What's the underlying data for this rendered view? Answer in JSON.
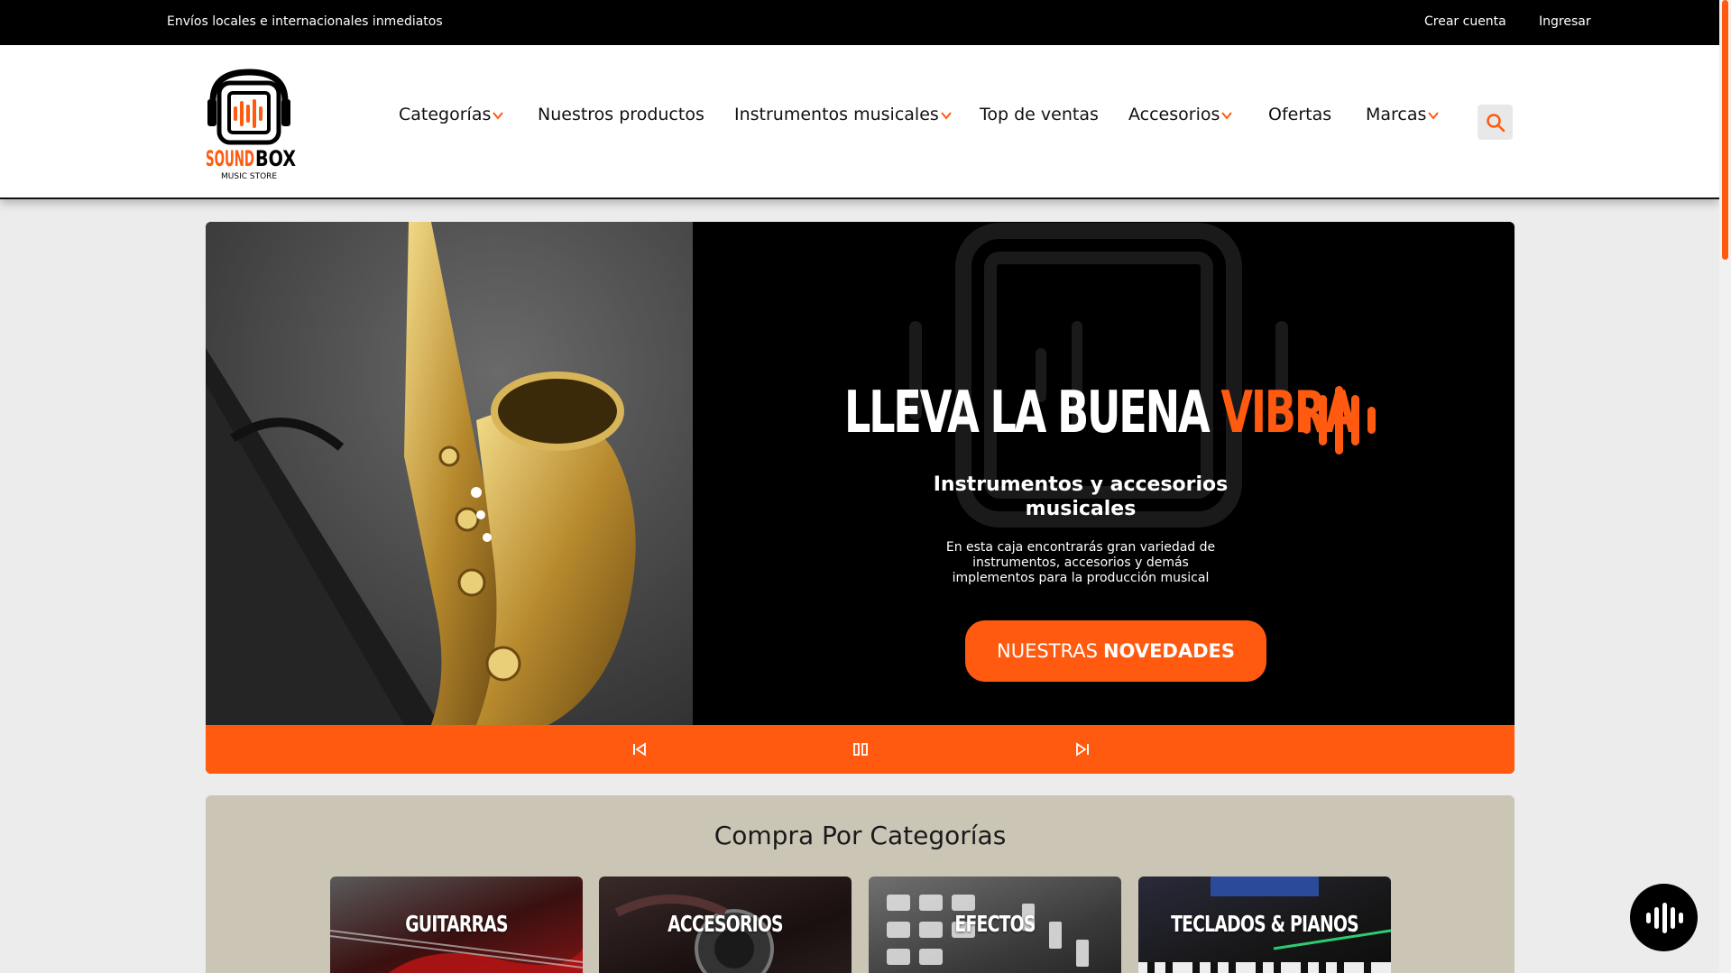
{
  "topbar": {
    "shipping_text": "Envíos locales e internacionales inmediatos",
    "create_account": "Crear cuenta",
    "login": "Ingresar"
  },
  "logo": {
    "brand": "SOUNDBOX",
    "tagline": "MUSIC STORE"
  },
  "nav": {
    "items": [
      {
        "label": "Categorías",
        "has_dropdown": true
      },
      {
        "label": "Nuestros productos",
        "has_dropdown": false
      },
      {
        "label": "Instrumentos musicales",
        "has_dropdown": true
      },
      {
        "label": "Top de ventas",
        "has_dropdown": false
      },
      {
        "label": "Accesorios",
        "has_dropdown": true
      },
      {
        "label": "Ofertas",
        "has_dropdown": false
      },
      {
        "label": "Marcas",
        "has_dropdown": true
      }
    ],
    "search_icon": "search-icon"
  },
  "hero": {
    "title_main": "LLEVA LA BUENA ",
    "title_accent": "VIBRA",
    "subtitle": "Instrumentos y accesorios musicales",
    "description": "En esta caja encontrarás gran variedad de instrumentos, accesorios y demás implementos para la producción musical",
    "cta_light": "NUESTRAS",
    "cta_bold": "NOVEDADES",
    "controls": [
      "previous-icon",
      "pause-icon",
      "next-icon"
    ]
  },
  "categories": {
    "title": "Compra Por Categorías",
    "items": [
      {
        "label": "GUITARRAS"
      },
      {
        "label": "ACCESORIOS"
      },
      {
        "label": "EFECTOS"
      },
      {
        "label": "TECLADOS & PIANOS"
      }
    ]
  },
  "colors": {
    "accent": "#ff5a0f",
    "topbar": "#000000",
    "category_bg": "#cbc5b6"
  }
}
